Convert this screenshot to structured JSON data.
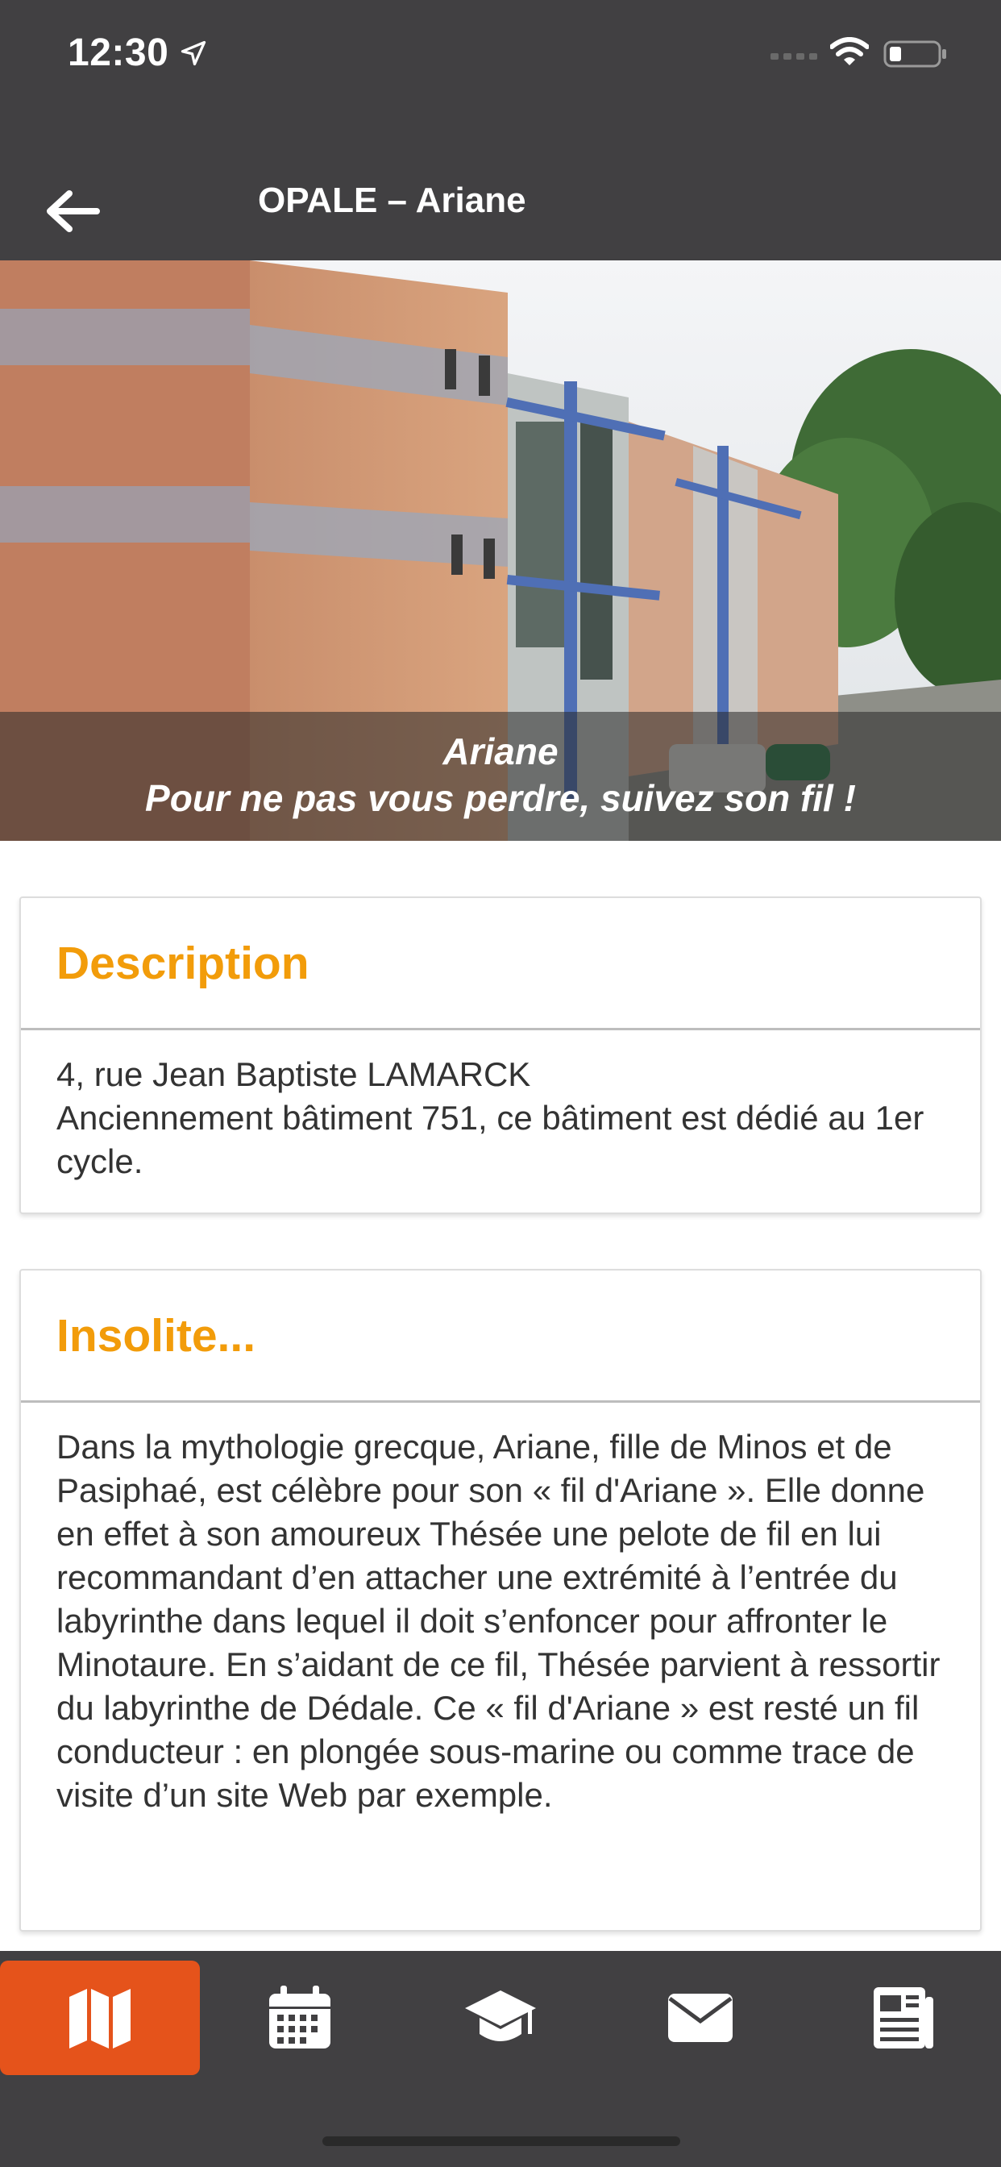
{
  "status_bar": {
    "time": "12:30",
    "icons": [
      "location-arrow-icon",
      "cell-signal-icon",
      "wifi-icon",
      "battery-icon"
    ]
  },
  "header": {
    "title": "OPALE – Ariane",
    "back_icon": "arrow-left-icon"
  },
  "hero": {
    "caption_title": "Ariane",
    "caption_subtitle": "Pour ne pas vous perdre, suivez son fil !"
  },
  "description": {
    "title": "Description",
    "lines": [
      "4, rue Jean Baptiste LAMARCK",
      "Anciennement bâtiment 751, ce bâtiment est dédié au 1er cycle."
    ]
  },
  "insolite": {
    "title": "Insolite...",
    "text": "Dans la mythologie grecque, Ariane, fille de Minos et de Pasiphaé, est célèbre pour son « fil d'Ariane ». Elle donne en effet à son amoureux Thésée une pelote de fil en lui recommandant d’en attacher une extrémité à l’entrée du labyrinthe dans lequel il doit s’enfoncer pour affronter le Minotaure. En s’aidant de ce fil, Thésée parvient à ressortir du labyrinthe de Dédale. Ce « fil d'Ariane » est resté un fil conducteur : en plongée sous-marine ou comme trace de visite d’un site Web par exemple."
  },
  "tabbar": {
    "items": [
      {
        "icon": "map-icon",
        "active": true
      },
      {
        "icon": "calendar-icon",
        "active": false
      },
      {
        "icon": "graduation-cap-icon",
        "active": false
      },
      {
        "icon": "envelope-icon",
        "active": false
      },
      {
        "icon": "newspaper-icon",
        "active": false
      }
    ]
  },
  "colors": {
    "bar_background": "#414042",
    "accent_orange": "#f29c0a",
    "active_tab": "#e5531b"
  }
}
